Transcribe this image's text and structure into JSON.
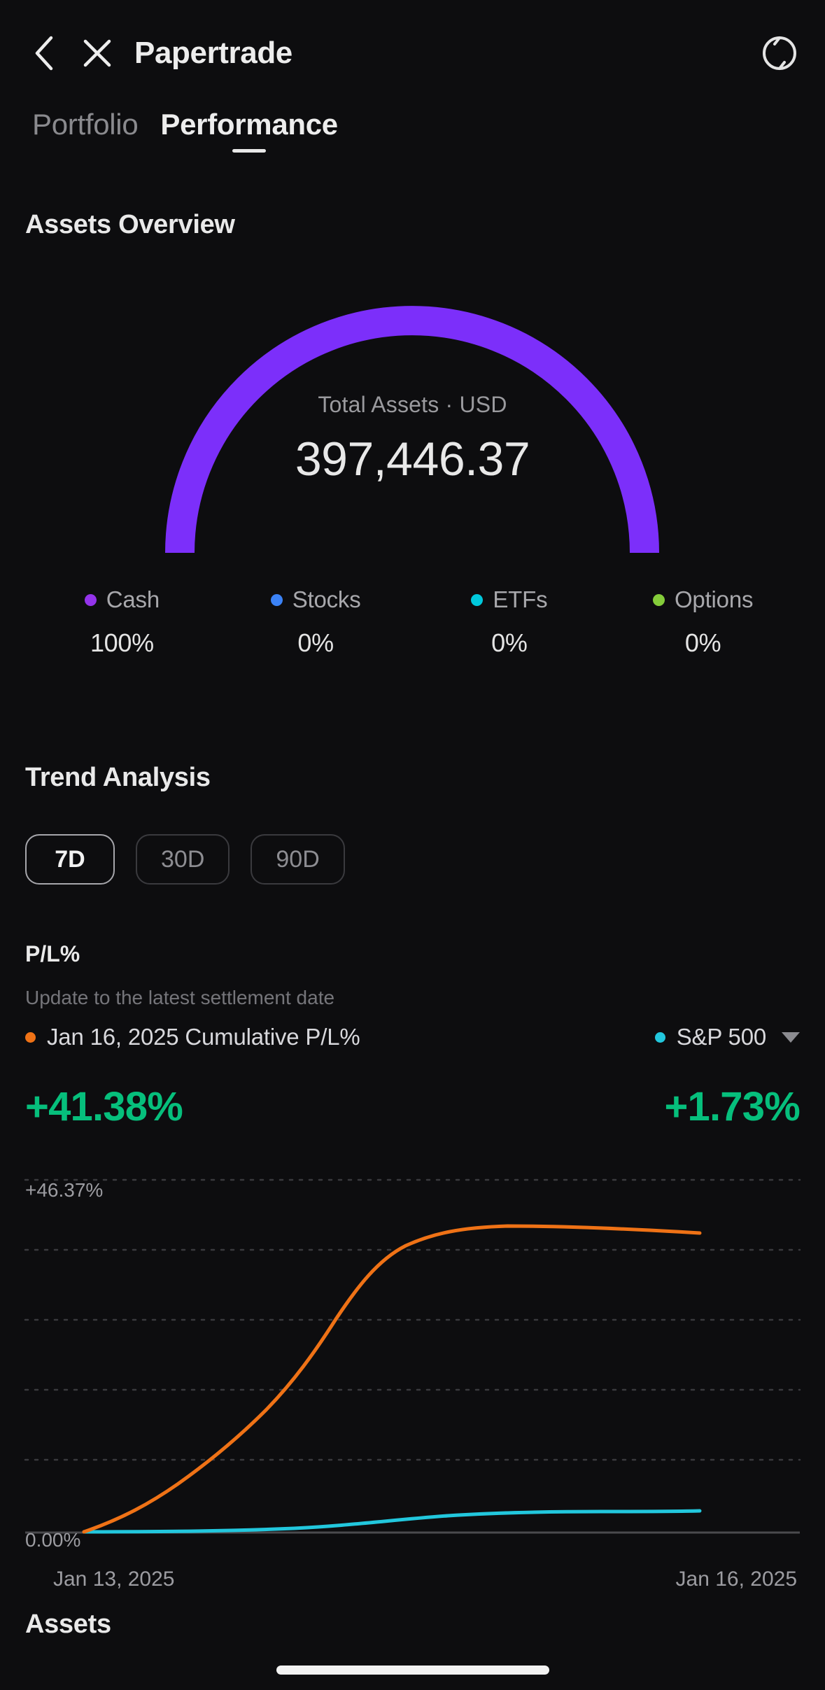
{
  "navbar": {
    "title": "Papertrade",
    "back_icon": "chevron-left-icon",
    "close_icon": "close-icon",
    "refresh_icon": "refresh-icon"
  },
  "tabs": [
    {
      "label": "Portfolio",
      "active": false
    },
    {
      "label": "Performance",
      "active": true
    }
  ],
  "assets_overview": {
    "title": "Assets Overview",
    "gauge": {
      "caption": "Total Assets · USD",
      "value": "397,446.37",
      "arc_color": "#7c2ffa",
      "arc_fill_fraction": 1.0
    },
    "allocation": [
      {
        "name": "Cash",
        "percent": "100%",
        "color": "#9333ea"
      },
      {
        "name": "Stocks",
        "percent": "0%",
        "color": "#3b82f6"
      },
      {
        "name": "ETFs",
        "percent": "0%",
        "color": "#00c8dc"
      },
      {
        "name": "Options",
        "percent": "0%",
        "color": "#84cc3a"
      }
    ]
  },
  "trend_analysis": {
    "title": "Trend Analysis",
    "ranges": [
      {
        "label": "7D",
        "selected": true
      },
      {
        "label": "30D",
        "selected": false
      },
      {
        "label": "90D",
        "selected": false
      }
    ],
    "pl_title": "P/L%",
    "pl_subtitle": "Update to the latest settlement date",
    "primary": {
      "legend": "Jan 16, 2025 Cumulative P/L%",
      "value": "+41.38%",
      "color": "#ef7216",
      "value_color": "#06bf7c"
    },
    "benchmark": {
      "legend": "S&P 500",
      "value": "+1.73%",
      "color": "#22c7dd",
      "value_color": "#06bf7c",
      "dropdown_icon": "chevron-down-icon"
    }
  },
  "chart_data": {
    "type": "line",
    "title": "P/L%",
    "xlabel": "",
    "ylabel": "",
    "grid": true,
    "legend_position": "top",
    "x_tick_labels": [
      "Jan 13, 2025",
      "Jan 16, 2025"
    ],
    "y_tick_labels": [
      "0.00%",
      "+46.37%"
    ],
    "ylim": [
      0,
      46.37
    ],
    "gridlines": [
      0,
      9.274,
      18.548,
      27.822,
      37.096,
      46.37
    ],
    "x": [
      "Jan 13, 2025",
      "Jan 13, 2025",
      "Jan 14, 2025",
      "Jan 14, 2025",
      "Jan 15, 2025",
      "Jan 15, 2025",
      "Jan 16, 2025",
      "Jan 16, 2025"
    ],
    "series": [
      {
        "name": "Jan 16, 2025 Cumulative P/L%",
        "color": "#ef7216",
        "values": [
          0.0,
          3.2,
          8.6,
          15.4,
          25.8,
          36.2,
          42.1,
          41.38
        ]
      },
      {
        "name": "S&P 500",
        "color": "#22c7dd",
        "values": [
          0.0,
          0.05,
          0.12,
          0.35,
          0.95,
          1.6,
          1.86,
          1.73
        ]
      }
    ]
  },
  "assets_section": {
    "title": "Assets"
  }
}
